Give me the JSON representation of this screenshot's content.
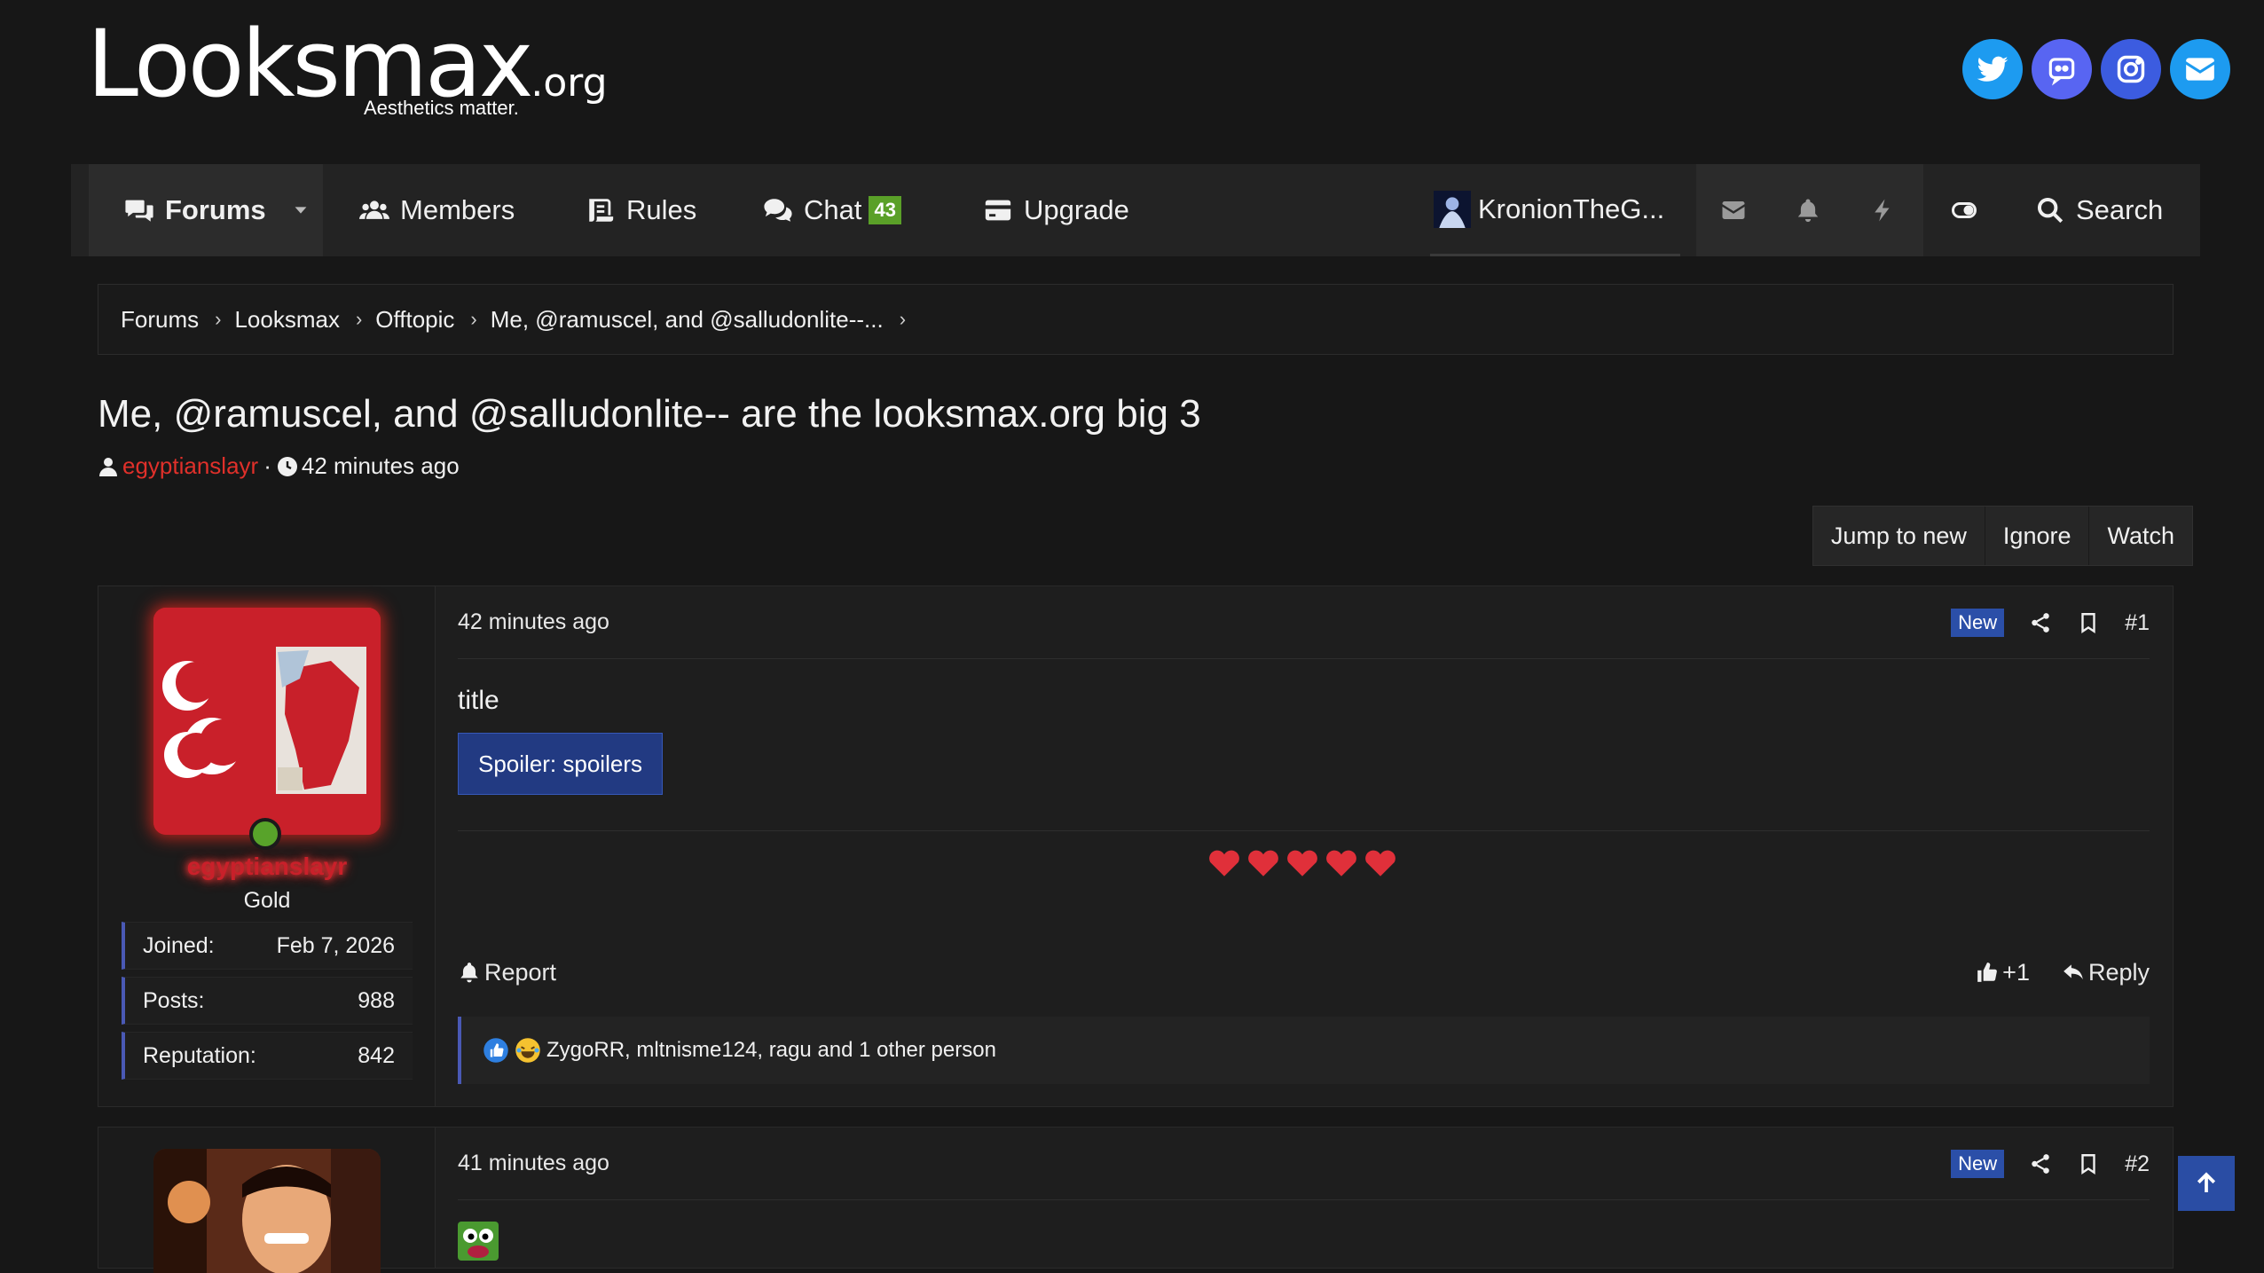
{
  "header": {
    "logo_main": "Looksmax",
    "logo_tld": ".org",
    "tagline": "Aesthetics matter.",
    "socials": [
      {
        "name": "twitter-icon",
        "color": "#1d9bf0"
      },
      {
        "name": "discord-icon",
        "color": "#5865f2"
      },
      {
        "name": "instagram-icon",
        "color": "#3c5ce0"
      },
      {
        "name": "email-icon",
        "color": "#1d9bf0"
      }
    ]
  },
  "nav": {
    "forums": "Forums",
    "members": "Members",
    "rules": "Rules",
    "chat": "Chat",
    "chat_count": "43",
    "upgrade": "Upgrade",
    "user": "KronionTheG...",
    "search": "Search"
  },
  "breadcrumb": {
    "items": [
      "Forums",
      "Looksmax",
      "Offtopic",
      "Me, @ramuscel, and @salludonlite--..."
    ]
  },
  "thread": {
    "title": "Me, @ramuscel, and @salludonlite-- are the looksmax.org big 3",
    "author": "egyptianslayr",
    "meta_sep": "·",
    "time": "42 minutes ago"
  },
  "actions": {
    "jump": "Jump to new",
    "ignore": "Ignore",
    "watch": "Watch"
  },
  "posts": [
    {
      "time": "42 minutes ago",
      "badge": "New",
      "number": "#1",
      "username": "egyptianslayr",
      "rank": "Gold",
      "stats": [
        {
          "label": "Joined:",
          "value": "Feb 7, 2026"
        },
        {
          "label": "Posts:",
          "value": "988"
        },
        {
          "label": "Reputation:",
          "value": "842"
        }
      ],
      "text": "title",
      "spoiler": "Spoiler: spoilers",
      "report": "Report",
      "like": "+1",
      "reply": "Reply",
      "reactions": "ZygoRR, mltnisme124, ragu and 1 other person"
    },
    {
      "time": "41 minutes ago",
      "badge": "New",
      "number": "#2"
    }
  ],
  "colors": {
    "accent_blue": "#2a4da4",
    "badge_green": "#5aa028",
    "user_red": "#e0302a",
    "stat_border": "#4a59b5"
  }
}
